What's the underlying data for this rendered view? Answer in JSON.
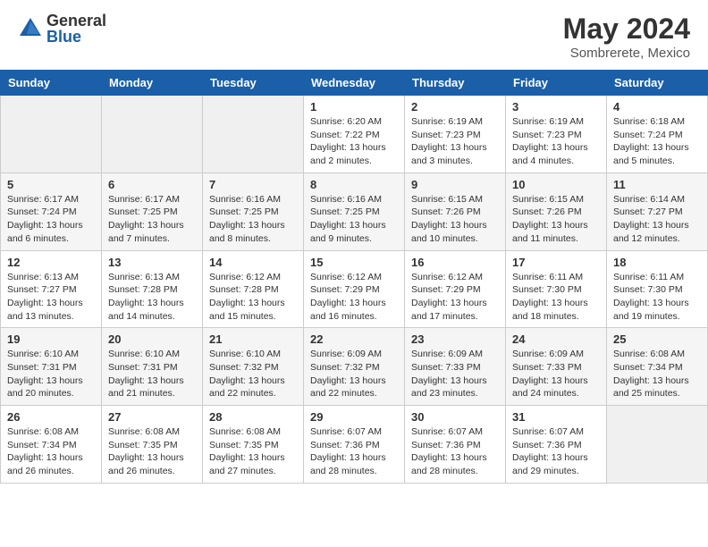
{
  "app": {
    "logo_general": "General",
    "logo_blue": "Blue",
    "month_year": "May 2024",
    "location": "Sombrerete, Mexico"
  },
  "calendar": {
    "headers": [
      "Sunday",
      "Monday",
      "Tuesday",
      "Wednesday",
      "Thursday",
      "Friday",
      "Saturday"
    ],
    "weeks": [
      {
        "days": [
          {
            "num": "",
            "content": ""
          },
          {
            "num": "",
            "content": ""
          },
          {
            "num": "",
            "content": ""
          },
          {
            "num": "1",
            "content": "Sunrise: 6:20 AM\nSunset: 7:22 PM\nDaylight: 13 hours\nand 2 minutes."
          },
          {
            "num": "2",
            "content": "Sunrise: 6:19 AM\nSunset: 7:23 PM\nDaylight: 13 hours\nand 3 minutes."
          },
          {
            "num": "3",
            "content": "Sunrise: 6:19 AM\nSunset: 7:23 PM\nDaylight: 13 hours\nand 4 minutes."
          },
          {
            "num": "4",
            "content": "Sunrise: 6:18 AM\nSunset: 7:24 PM\nDaylight: 13 hours\nand 5 minutes."
          }
        ]
      },
      {
        "days": [
          {
            "num": "5",
            "content": "Sunrise: 6:17 AM\nSunset: 7:24 PM\nDaylight: 13 hours\nand 6 minutes."
          },
          {
            "num": "6",
            "content": "Sunrise: 6:17 AM\nSunset: 7:25 PM\nDaylight: 13 hours\nand 7 minutes."
          },
          {
            "num": "7",
            "content": "Sunrise: 6:16 AM\nSunset: 7:25 PM\nDaylight: 13 hours\nand 8 minutes."
          },
          {
            "num": "8",
            "content": "Sunrise: 6:16 AM\nSunset: 7:25 PM\nDaylight: 13 hours\nand 9 minutes."
          },
          {
            "num": "9",
            "content": "Sunrise: 6:15 AM\nSunset: 7:26 PM\nDaylight: 13 hours\nand 10 minutes."
          },
          {
            "num": "10",
            "content": "Sunrise: 6:15 AM\nSunset: 7:26 PM\nDaylight: 13 hours\nand 11 minutes."
          },
          {
            "num": "11",
            "content": "Sunrise: 6:14 AM\nSunset: 7:27 PM\nDaylight: 13 hours\nand 12 minutes."
          }
        ]
      },
      {
        "days": [
          {
            "num": "12",
            "content": "Sunrise: 6:13 AM\nSunset: 7:27 PM\nDaylight: 13 hours\nand 13 minutes."
          },
          {
            "num": "13",
            "content": "Sunrise: 6:13 AM\nSunset: 7:28 PM\nDaylight: 13 hours\nand 14 minutes."
          },
          {
            "num": "14",
            "content": "Sunrise: 6:12 AM\nSunset: 7:28 PM\nDaylight: 13 hours\nand 15 minutes."
          },
          {
            "num": "15",
            "content": "Sunrise: 6:12 AM\nSunset: 7:29 PM\nDaylight: 13 hours\nand 16 minutes."
          },
          {
            "num": "16",
            "content": "Sunrise: 6:12 AM\nSunset: 7:29 PM\nDaylight: 13 hours\nand 17 minutes."
          },
          {
            "num": "17",
            "content": "Sunrise: 6:11 AM\nSunset: 7:30 PM\nDaylight: 13 hours\nand 18 minutes."
          },
          {
            "num": "18",
            "content": "Sunrise: 6:11 AM\nSunset: 7:30 PM\nDaylight: 13 hours\nand 19 minutes."
          }
        ]
      },
      {
        "days": [
          {
            "num": "19",
            "content": "Sunrise: 6:10 AM\nSunset: 7:31 PM\nDaylight: 13 hours\nand 20 minutes."
          },
          {
            "num": "20",
            "content": "Sunrise: 6:10 AM\nSunset: 7:31 PM\nDaylight: 13 hours\nand 21 minutes."
          },
          {
            "num": "21",
            "content": "Sunrise: 6:10 AM\nSunset: 7:32 PM\nDaylight: 13 hours\nand 22 minutes."
          },
          {
            "num": "22",
            "content": "Sunrise: 6:09 AM\nSunset: 7:32 PM\nDaylight: 13 hours\nand 22 minutes."
          },
          {
            "num": "23",
            "content": "Sunrise: 6:09 AM\nSunset: 7:33 PM\nDaylight: 13 hours\nand 23 minutes."
          },
          {
            "num": "24",
            "content": "Sunrise: 6:09 AM\nSunset: 7:33 PM\nDaylight: 13 hours\nand 24 minutes."
          },
          {
            "num": "25",
            "content": "Sunrise: 6:08 AM\nSunset: 7:34 PM\nDaylight: 13 hours\nand 25 minutes."
          }
        ]
      },
      {
        "days": [
          {
            "num": "26",
            "content": "Sunrise: 6:08 AM\nSunset: 7:34 PM\nDaylight: 13 hours\nand 26 minutes."
          },
          {
            "num": "27",
            "content": "Sunrise: 6:08 AM\nSunset: 7:35 PM\nDaylight: 13 hours\nand 26 minutes."
          },
          {
            "num": "28",
            "content": "Sunrise: 6:08 AM\nSunset: 7:35 PM\nDaylight: 13 hours\nand 27 minutes."
          },
          {
            "num": "29",
            "content": "Sunrise: 6:07 AM\nSunset: 7:36 PM\nDaylight: 13 hours\nand 28 minutes."
          },
          {
            "num": "30",
            "content": "Sunrise: 6:07 AM\nSunset: 7:36 PM\nDaylight: 13 hours\nand 28 minutes."
          },
          {
            "num": "31",
            "content": "Sunrise: 6:07 AM\nSunset: 7:36 PM\nDaylight: 13 hours\nand 29 minutes."
          },
          {
            "num": "",
            "content": ""
          }
        ]
      }
    ]
  }
}
